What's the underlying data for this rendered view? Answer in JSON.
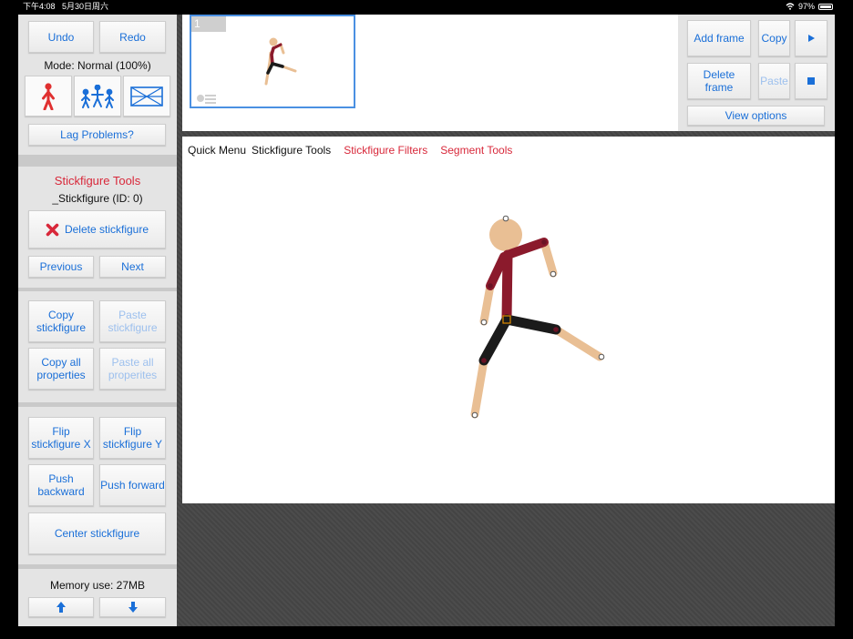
{
  "statusbar": {
    "time": "下午4:08",
    "date": "5月30日周六",
    "battery": "97%"
  },
  "sidebar": {
    "undo": "Undo",
    "redo": "Redo",
    "mode": "Mode: Normal (100%)",
    "lag": "Lag Problems?",
    "tools_title": "Stickfigure Tools",
    "stick_id": "_Stickfigure (ID: 0)",
    "delete": "Delete stickfigure",
    "previous": "Previous",
    "next": "Next",
    "copy_stick": "Copy stickfigure",
    "paste_stick": "Paste stickfigure",
    "copy_all": "Copy all properties",
    "paste_all": "Paste all properites",
    "flip_x": "Flip stickfigure X",
    "flip_y": "Flip stickfigure Y",
    "push_back": "Push backward",
    "push_fwd": "Push forward",
    "center": "Center stickfigure",
    "memory": "Memory use: 27MB"
  },
  "topbar": {
    "frame_number": "1",
    "add_frame": "Add frame",
    "copy": "Copy",
    "delete_frame": "Delete frame",
    "paste": "Paste",
    "view_options": "View options"
  },
  "menu": {
    "quick": "Quick Menu",
    "stick_tools": "Stickfigure Tools",
    "filters": "Stickfigure Filters",
    "segment": "Segment Tools"
  },
  "colors": {
    "accent": "#1a6fd8",
    "red": "#d8283a",
    "skin": "#e9bf94",
    "shirt": "#8b1a2c",
    "pants": "#1b1b1b"
  }
}
